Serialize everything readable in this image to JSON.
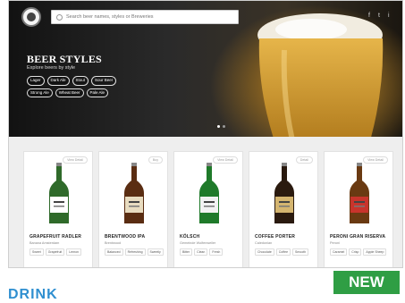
{
  "header": {
    "search_placeholder": "Search beer names, styles or Breweries",
    "social": [
      "f",
      "t",
      "i"
    ]
  },
  "hero": {
    "title": "BEER STYLES",
    "subtitle": "Explore beers by style",
    "chips": [
      "Lager",
      "Dark Ale",
      "Stout",
      "Sour Beer",
      "Strong Ale",
      "Wheat Beer",
      "Pale Ale"
    ]
  },
  "cards": [
    {
      "badge": "View Detail",
      "name": "GRAPEFRUIT RADLER",
      "brewery": "Banana Amsterdam",
      "tags": [
        "Sweet",
        "Grapefruit",
        "Lemon"
      ],
      "bottle_color": "#2f6a2a",
      "label_color": "#ffffff"
    },
    {
      "badge": "Buy",
      "name": "BRENTWOOD IPA",
      "brewery": "Brentwood",
      "tags": [
        "Balanced",
        "Refreshing",
        "Sweetly"
      ],
      "bottle_color": "#5a2d12",
      "label_color": "#e8dcc0"
    },
    {
      "badge": "View Detail",
      "name": "KÖLSCH",
      "brewery": "Gemeinde Wolfenweiler",
      "tags": [
        "Bitter",
        "Clean",
        "Fresh"
      ],
      "bottle_color": "#1f7a2a",
      "label_color": "#f2f2f2"
    },
    {
      "badge": "Detail",
      "name": "COFFEE PORTER",
      "brewery": "Caledonian",
      "tags": [
        "Chocolate",
        "Coffee",
        "Smooth"
      ],
      "bottle_color": "#2a1a0f",
      "label_color": "#d4b570"
    },
    {
      "badge": "View Detail",
      "name": "PERONI GRAN RISERVA",
      "brewery": "Peroni",
      "tags": [
        "Caramel",
        "Crisp",
        "Apple Sheep"
      ],
      "bottle_color": "#6a3a12",
      "label_color": "#c8342c"
    }
  ],
  "footer": {
    "new_label": "NEW",
    "drink_label": "DRINK"
  },
  "colors": {
    "accent": "#2f9e44",
    "link": "#2f8fd0"
  }
}
